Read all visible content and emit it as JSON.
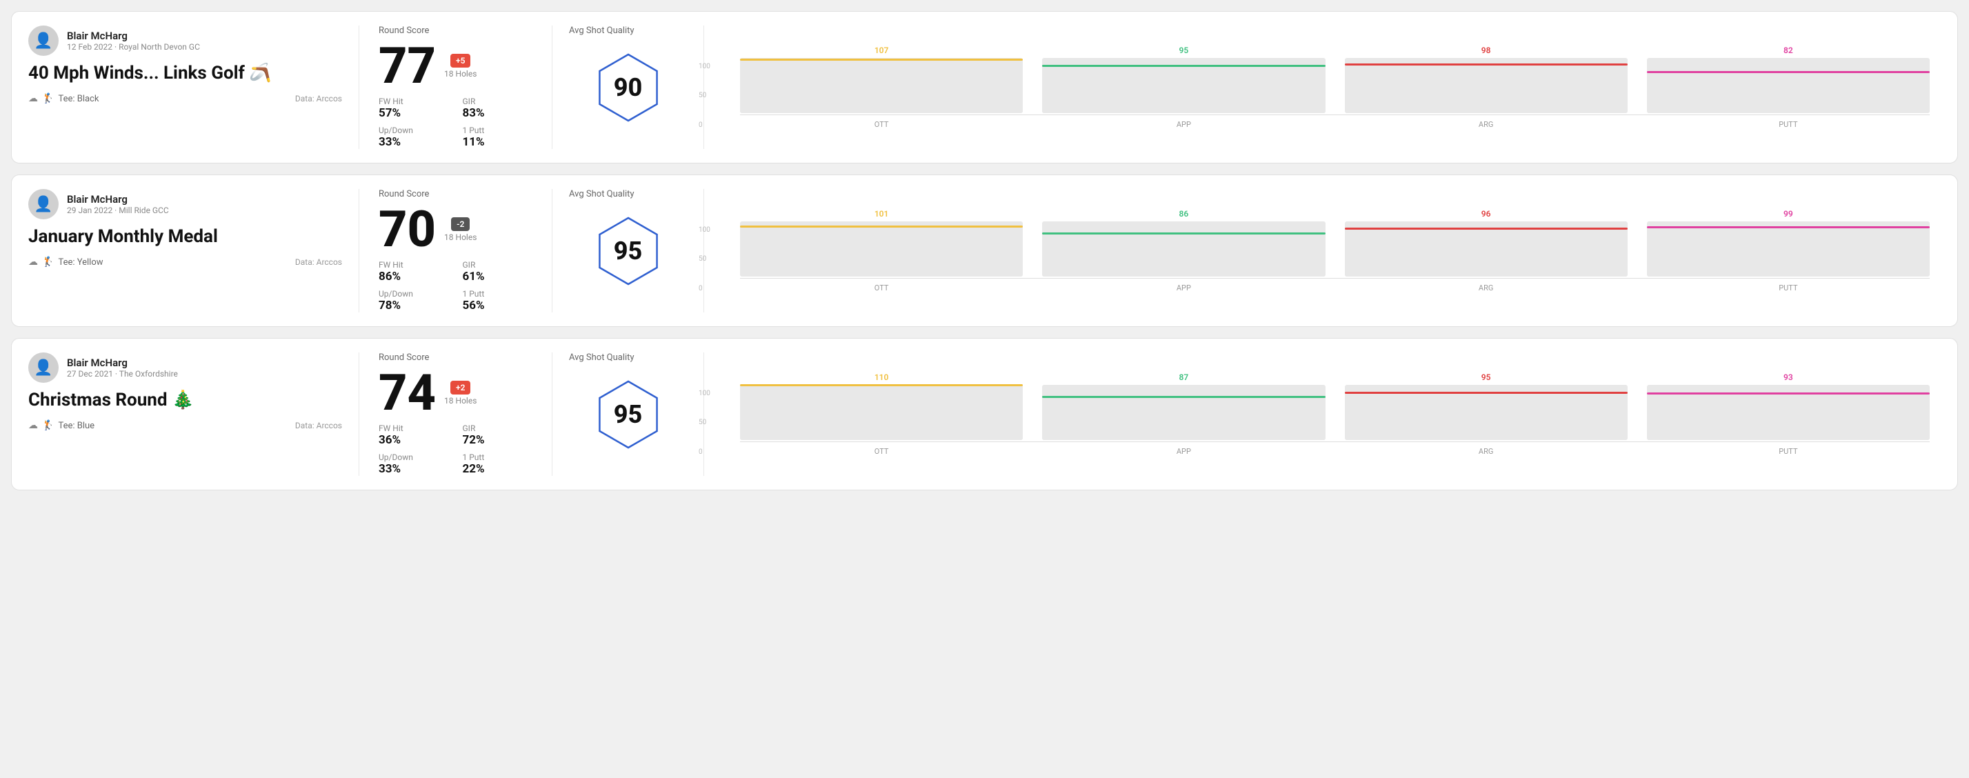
{
  "rounds": [
    {
      "player": "Blair McHarg",
      "date": "12 Feb 2022 · Royal North Devon GC",
      "title": "40 Mph Winds... Links Golf 🪃",
      "tee": "Tee: Black",
      "data_source": "Data: Arccos",
      "round_score_label": "Round Score",
      "score": "77",
      "badge": "+5",
      "badge_type": "plus",
      "holes": "18 Holes",
      "fw_hit_label": "FW Hit",
      "fw_hit": "57%",
      "gir_label": "GIR",
      "gir": "83%",
      "updown_label": "Up/Down",
      "updown": "33%",
      "putt_label": "1 Putt",
      "putt": "11%",
      "quality_label": "Avg Shot Quality",
      "quality_score": "90",
      "chart": {
        "bars": [
          {
            "label": "OTT",
            "value": 107,
            "color": "#f0c040"
          },
          {
            "label": "APP",
            "value": 95,
            "color": "#40c080"
          },
          {
            "label": "ARG",
            "value": 98,
            "color": "#e04040"
          },
          {
            "label": "PUTT",
            "value": 82,
            "color": "#e040a0"
          }
        ],
        "max": 110,
        "y_labels": [
          "100",
          "50",
          "0"
        ]
      }
    },
    {
      "player": "Blair McHarg",
      "date": "29 Jan 2022 · Mill Ride GCC",
      "title": "January Monthly Medal",
      "tee": "Tee: Yellow",
      "data_source": "Data: Arccos",
      "round_score_label": "Round Score",
      "score": "70",
      "badge": "-2",
      "badge_type": "minus",
      "holes": "18 Holes",
      "fw_hit_label": "FW Hit",
      "fw_hit": "86%",
      "gir_label": "GIR",
      "gir": "61%",
      "updown_label": "Up/Down",
      "updown": "78%",
      "putt_label": "1 Putt",
      "putt": "56%",
      "quality_label": "Avg Shot Quality",
      "quality_score": "95",
      "chart": {
        "bars": [
          {
            "label": "OTT",
            "value": 101,
            "color": "#f0c040"
          },
          {
            "label": "APP",
            "value": 86,
            "color": "#40c080"
          },
          {
            "label": "ARG",
            "value": 96,
            "color": "#e04040"
          },
          {
            "label": "PUTT",
            "value": 99,
            "color": "#e040a0"
          }
        ],
        "max": 110,
        "y_labels": [
          "100",
          "50",
          "0"
        ]
      }
    },
    {
      "player": "Blair McHarg",
      "date": "27 Dec 2021 · The Oxfordshire",
      "title": "Christmas Round 🎄",
      "tee": "Tee: Blue",
      "data_source": "Data: Arccos",
      "round_score_label": "Round Score",
      "score": "74",
      "badge": "+2",
      "badge_type": "plus",
      "holes": "18 Holes",
      "fw_hit_label": "FW Hit",
      "fw_hit": "36%",
      "gir_label": "GIR",
      "gir": "72%",
      "updown_label": "Up/Down",
      "updown": "33%",
      "putt_label": "1 Putt",
      "putt": "22%",
      "quality_label": "Avg Shot Quality",
      "quality_score": "95",
      "chart": {
        "bars": [
          {
            "label": "OTT",
            "value": 110,
            "color": "#f0c040"
          },
          {
            "label": "APP",
            "value": 87,
            "color": "#40c080"
          },
          {
            "label": "ARG",
            "value": 95,
            "color": "#e04040"
          },
          {
            "label": "PUTT",
            "value": 93,
            "color": "#e040a0"
          }
        ],
        "max": 110,
        "y_labels": [
          "100",
          "50",
          "0"
        ]
      }
    }
  ]
}
